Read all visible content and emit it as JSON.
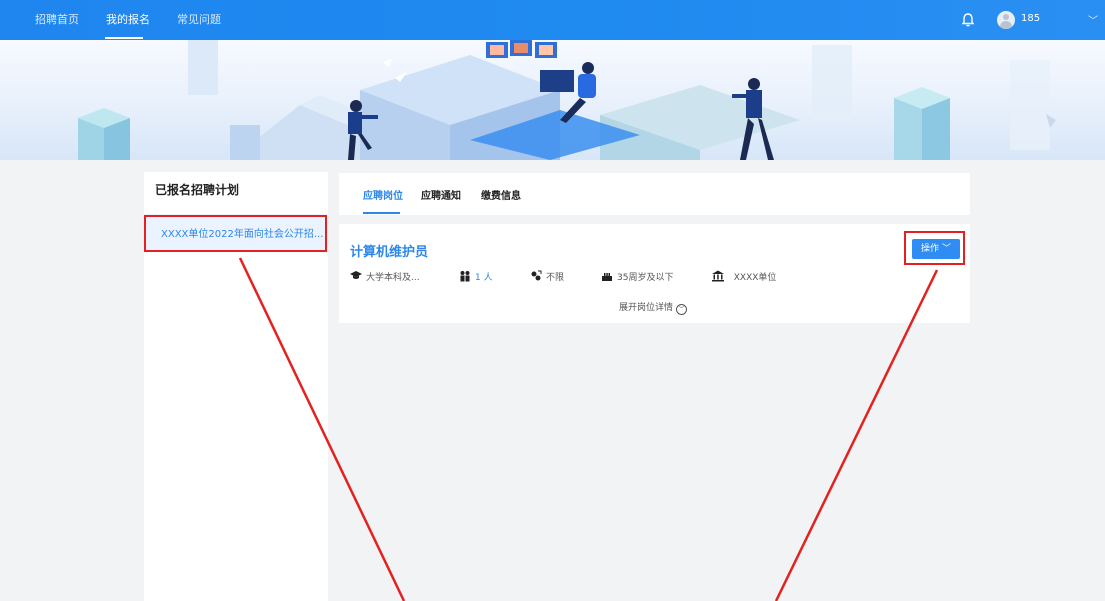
{
  "nav": {
    "items": [
      {
        "label": "招聘首页",
        "active": false
      },
      {
        "label": "我的报名",
        "active": true
      },
      {
        "label": "常见问题",
        "active": false
      }
    ],
    "user_name": "185",
    "icons": [
      "bell-icon",
      "avatar-icon",
      "chevron-down-icon"
    ]
  },
  "left_panel": {
    "title": "已报名招聘计划",
    "plans": [
      "XXXX单位2022年面向社会公开招..."
    ]
  },
  "tabs": [
    {
      "label": "应聘岗位",
      "active": true
    },
    {
      "label": "应聘通知",
      "active": false
    },
    {
      "label": "缴费信息",
      "active": false
    }
  ],
  "job": {
    "title": "计算机维护员",
    "action_label": "操作",
    "education": "大学本科及...",
    "headcount_value": "1",
    "headcount_unit": "人",
    "gender": "不限",
    "age": "35周岁及以下",
    "org": "XXXX单位",
    "expand_label": "展开岗位详情"
  },
  "colors": {
    "primary": "#2d87e8",
    "nav_bg": "#1f86ef",
    "annotation": "#e52020",
    "page_bg": "#f2f3f5"
  }
}
